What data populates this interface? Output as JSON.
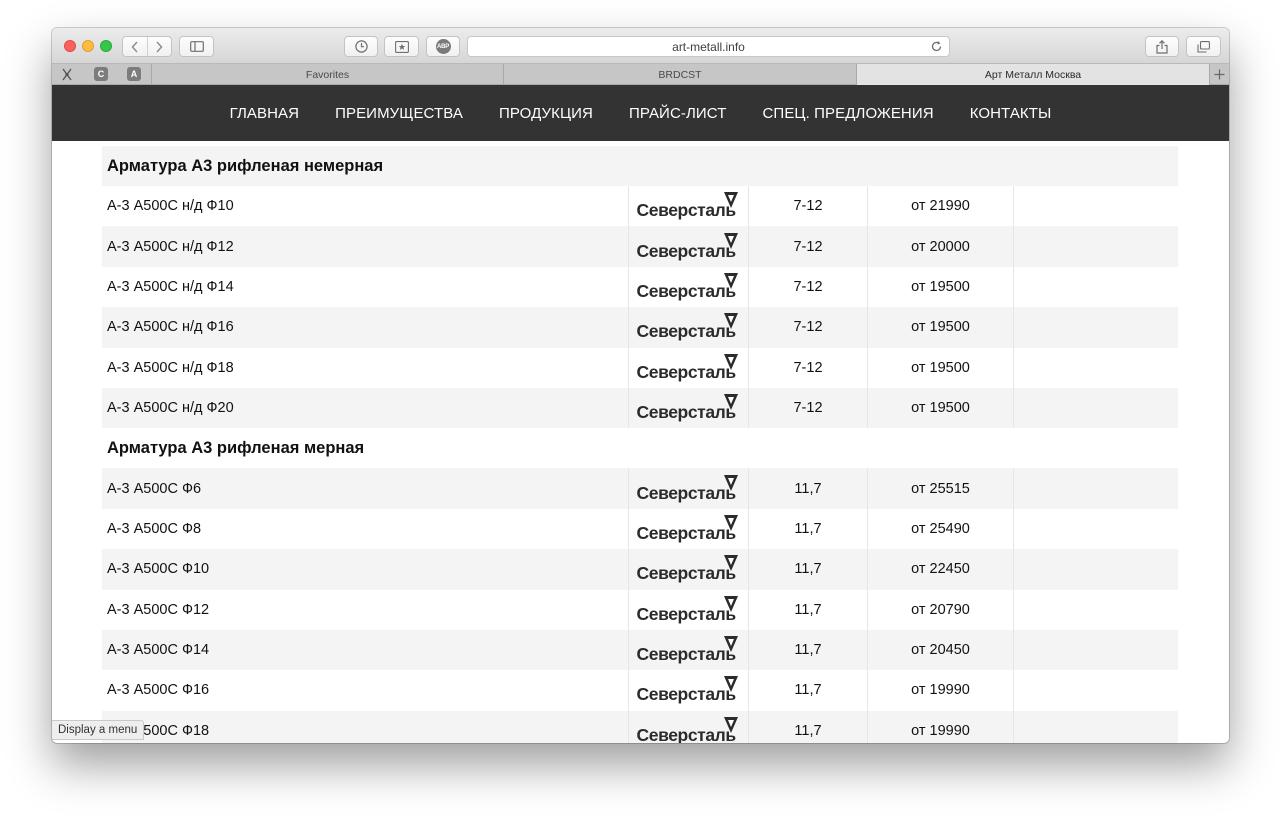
{
  "browser": {
    "address": "art-metall.info",
    "tabs": [
      {
        "label": "Favorites"
      },
      {
        "label": "BRDCST"
      },
      {
        "label": "Арт Металл Москва"
      }
    ],
    "extensions": [
      "C",
      "A"
    ],
    "abp_label": "ABP",
    "status_tooltip": "Display a menu"
  },
  "nav": {
    "items": [
      {
        "label": "ГЛАВНАЯ"
      },
      {
        "label": "ПРЕИМУЩЕСТВА"
      },
      {
        "label": "ПРОДУКЦИЯ"
      },
      {
        "label": "ПРАЙС-ЛИСТ"
      },
      {
        "label": "СПЕЦ. ПРЕДЛОЖЕНИЯ"
      },
      {
        "label": "КОНТАКТЫ"
      }
    ]
  },
  "brand": {
    "name": "Северсталь",
    "mark_color": "#2b2b2b"
  },
  "sections": [
    {
      "title": "Арматура А3 рифленая немерная",
      "rows": [
        {
          "name": "А-3 А500С н/д Ф10",
          "brand": "Северсталь",
          "length": "7-12",
          "price": "от 21990"
        },
        {
          "name": "А-3 А500С н/д Ф12",
          "brand": "Северсталь",
          "length": "7-12",
          "price": "от 20000"
        },
        {
          "name": "А-3 А500С н/д Ф14",
          "brand": "Северсталь",
          "length": "7-12",
          "price": "от 19500"
        },
        {
          "name": "А-3 А500С н/д Ф16",
          "brand": "Северсталь",
          "length": "7-12",
          "price": "от 19500"
        },
        {
          "name": "А-3 А500С н/д Ф18",
          "brand": "Северсталь",
          "length": "7-12",
          "price": "от 19500"
        },
        {
          "name": "А-3 А500С н/д Ф20",
          "brand": "Северсталь",
          "length": "7-12",
          "price": "от 19500"
        }
      ]
    },
    {
      "title": "Арматура А3 рифленая мерная",
      "rows": [
        {
          "name": "А-3 А500С Ф6",
          "brand": "Северсталь",
          "length": "11,7",
          "price": "от 25515"
        },
        {
          "name": "А-3 А500С Ф8",
          "brand": "Северсталь",
          "length": "11,7",
          "price": "от 25490"
        },
        {
          "name": "А-3 А500С Ф10",
          "brand": "Северсталь",
          "length": "11,7",
          "price": "от 22450"
        },
        {
          "name": "А-3 А500С Ф12",
          "brand": "Северсталь",
          "length": "11,7",
          "price": "от 20790"
        },
        {
          "name": "А-3 А500С Ф14",
          "brand": "Северсталь",
          "length": "11,7",
          "price": "от 20450"
        },
        {
          "name": "А-3 А500С Ф16",
          "brand": "Северсталь",
          "length": "11,7",
          "price": "от 19990"
        },
        {
          "name": "А-3 А500С Ф18",
          "brand": "Северсталь",
          "length": "11,7",
          "price": "от 19990"
        }
      ]
    }
  ]
}
